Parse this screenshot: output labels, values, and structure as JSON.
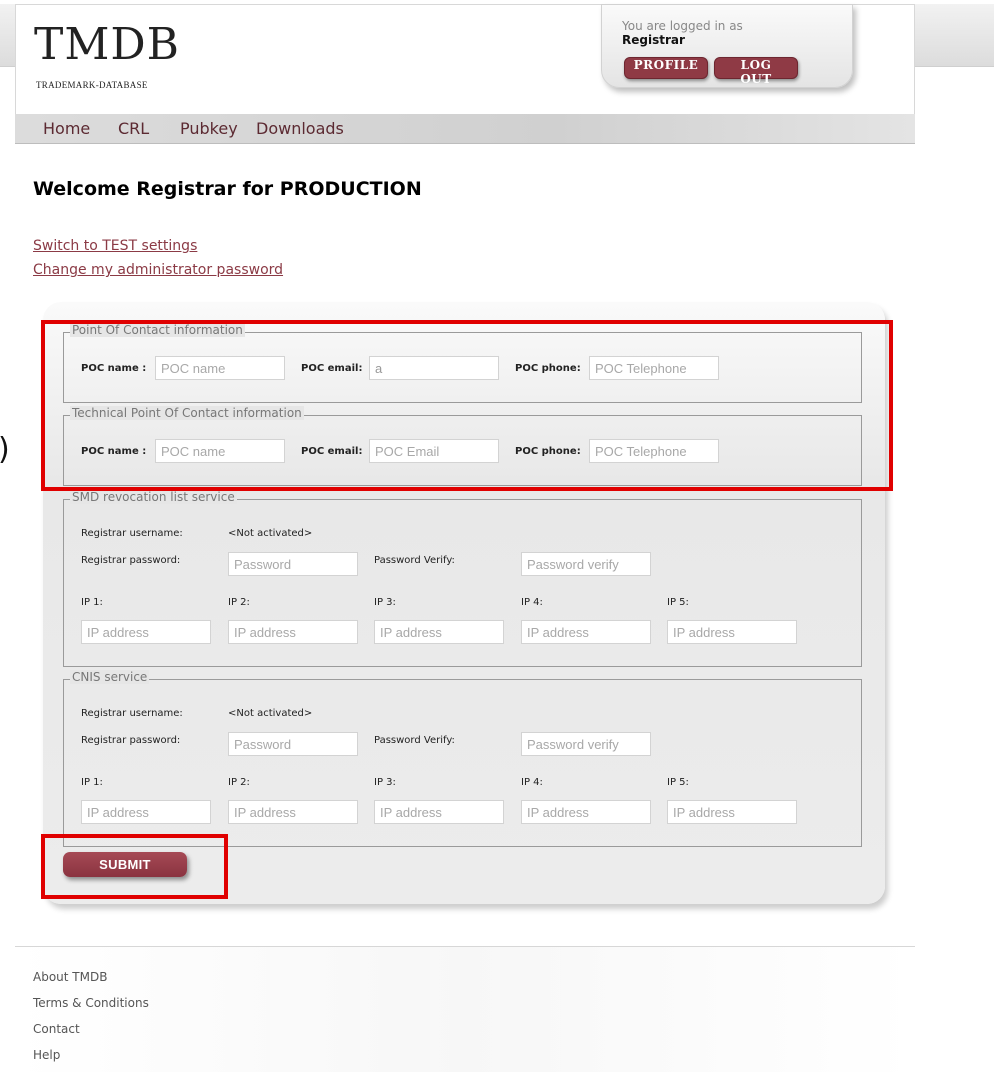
{
  "header": {
    "logo_title": "TMDB",
    "logo_subtitle": "TRADEMARK-DATABASE",
    "login_status": "You are logged in as",
    "login_user": "Registrar",
    "profile_label": "PROFILE",
    "logout_label": "LOG OUT"
  },
  "nav": {
    "items": [
      "Home",
      "CRL",
      "Pubkey",
      "Downloads"
    ]
  },
  "main": {
    "title": "Welcome Registrar  for PRODUCTION",
    "links": [
      "Switch to TEST settings",
      "Change my administrator password"
    ]
  },
  "poc": {
    "legend": "Point Of Contact information",
    "name_label": "POC name :",
    "name_placeholder": "POC name",
    "email_label": "POC email:",
    "email_value": "a",
    "phone_label": "POC phone:",
    "phone_placeholder": "POC Telephone"
  },
  "tech_poc": {
    "legend": "Technical Point Of Contact information",
    "name_label": "POC name :",
    "name_placeholder": "POC name",
    "email_label": "POC email:",
    "email_placeholder": "POC Email",
    "phone_label": "POC phone:",
    "phone_placeholder": "POC Telephone"
  },
  "smd": {
    "legend": "SMD revocation list service",
    "username_label": "Registrar username:",
    "username_value": "<Not activated>",
    "password_label": "Registrar password:",
    "password_placeholder": "Password",
    "verify_label": "Password Verify:",
    "verify_placeholder": "Password verify",
    "ip_labels": [
      "IP 1:",
      "IP 2:",
      "IP 3:",
      "IP 4:",
      "IP 5:"
    ],
    "ip_placeholder": "IP address"
  },
  "cnis": {
    "legend": "CNIS service",
    "username_label": "Registrar username:",
    "username_value": "<Not activated>",
    "password_label": "Registrar password:",
    "password_placeholder": "Password",
    "verify_label": "Password Verify:",
    "verify_placeholder": "Password verify",
    "ip_labels": [
      "IP 1:",
      "IP 2:",
      "IP 3:",
      "IP 4:",
      "IP 5:"
    ],
    "ip_placeholder": "IP address"
  },
  "submit_label": "SUBMIT",
  "footer": {
    "links": [
      "About TMDB",
      "Terms & Conditions",
      "Contact",
      "Help"
    ]
  },
  "annotation": {
    "paren": ")"
  },
  "colors": {
    "accent": "#8f3a45",
    "link": "#8b3a45",
    "highlight": "#e00000"
  }
}
